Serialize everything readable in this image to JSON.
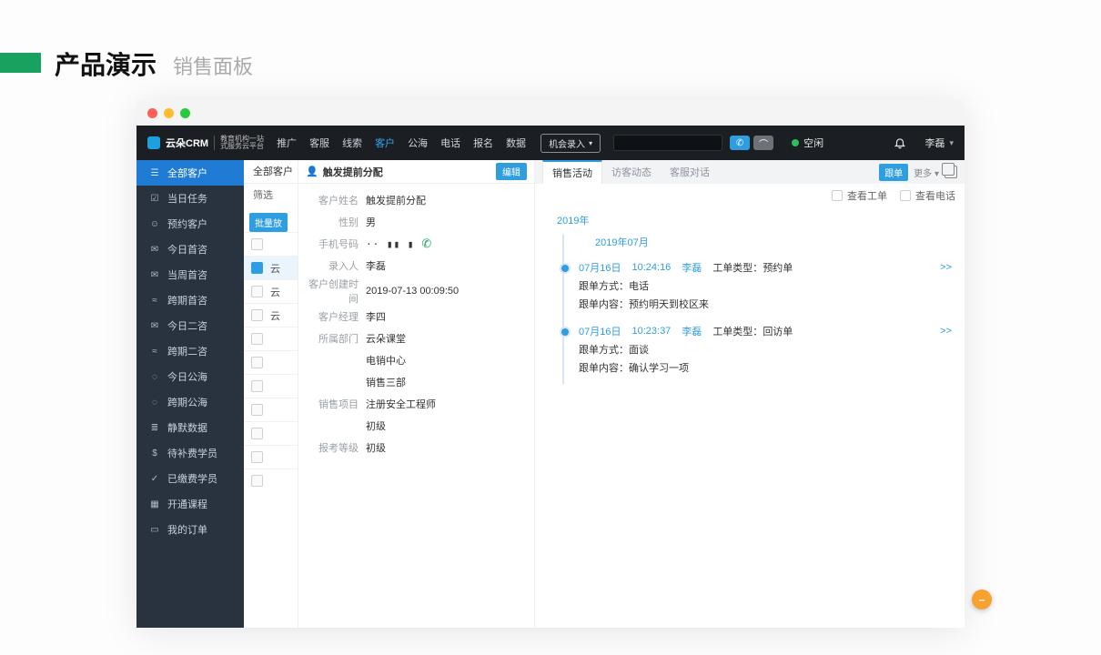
{
  "page": {
    "title": "产品演示",
    "subtitle": "销售面板"
  },
  "topnav": {
    "logo": {
      "brand": "云朵CRM",
      "sub1": "教育机构一站",
      "sub2": "式服务云平台"
    },
    "items": [
      "推广",
      "客服",
      "线索",
      "客户",
      "公海",
      "电话",
      "报名",
      "数据"
    ],
    "active_index": 3,
    "opportunity": "机会录入",
    "status_label": "空闲",
    "status_color": "#29c05a",
    "user": "李磊"
  },
  "sidebar": {
    "items": [
      {
        "icon": "users",
        "label": "全部客户",
        "head": true
      },
      {
        "icon": "task",
        "label": "当日任务"
      },
      {
        "icon": "person",
        "label": "预约客户"
      },
      {
        "icon": "chat",
        "label": "今日首咨"
      },
      {
        "icon": "chat",
        "label": "当周首咨"
      },
      {
        "icon": "wave",
        "label": "跨期首咨"
      },
      {
        "icon": "chat",
        "label": "今日二咨"
      },
      {
        "icon": "wave",
        "label": "跨期二咨"
      },
      {
        "icon": "sea",
        "label": "今日公海"
      },
      {
        "icon": "sea",
        "label": "跨期公海"
      },
      {
        "icon": "db",
        "label": "静默数据"
      },
      {
        "icon": "pay",
        "label": "待补费学员"
      },
      {
        "icon": "paid",
        "label": "已缴费学员"
      },
      {
        "icon": "course",
        "label": "开通课程"
      },
      {
        "icon": "order",
        "label": "我的订单"
      }
    ]
  },
  "mid": {
    "head": "全部客户",
    "filter": "筛选",
    "batch_badge": "批量放",
    "rows": [
      {
        "label": "",
        "chk": false
      },
      {
        "label": "云",
        "chk": true
      },
      {
        "label": "云",
        "chk": false
      },
      {
        "label": "云",
        "chk": false
      },
      {
        "label": "",
        "chk": false
      },
      {
        "label": "",
        "chk": false
      },
      {
        "label": "",
        "chk": false
      },
      {
        "label": "",
        "chk": false
      },
      {
        "label": "",
        "chk": false
      },
      {
        "label": "",
        "chk": false
      },
      {
        "label": "",
        "chk": false
      }
    ]
  },
  "detail": {
    "title": "触发提前分配",
    "edit": "编辑",
    "fields": [
      {
        "label": "客户姓名",
        "value": "触发提前分配"
      },
      {
        "label": "性别",
        "value": "男"
      },
      {
        "label": "手机号码",
        "value": "masked",
        "phone": true
      },
      {
        "label": "录入人",
        "value": "李磊"
      },
      {
        "label": "客户创建时间",
        "value": "2019-07-13 00:09:50"
      },
      {
        "label": "客户经理",
        "value": "李四"
      },
      {
        "label": "所属部门",
        "value": "云朵课堂"
      },
      {
        "label": "",
        "value": "电销中心"
      },
      {
        "label": "",
        "value": "销售三部"
      },
      {
        "label": "销售项目",
        "value": "注册安全工程师"
      },
      {
        "label": "",
        "value": "初级"
      },
      {
        "label": "报考等级",
        "value": "初级"
      }
    ]
  },
  "activity": {
    "tabs": [
      "销售活动",
      "访客动态",
      "客服对话"
    ],
    "active_tab": 0,
    "pill": "跟单",
    "more": "更多 ▾",
    "filters": {
      "ticket": "查看工单",
      "call": "查看电话"
    },
    "year": "2019年",
    "month": "2019年07月",
    "timeline": [
      {
        "date": "07月16日",
        "time": "10:24:16",
        "user": "李磊",
        "type_label": "工单类型：",
        "type_value": "预约单",
        "method_label": "跟单方式：",
        "method_value": "电话",
        "content_label": "跟单内容：",
        "content_value": "预约明天到校区来"
      },
      {
        "date": "07月16日",
        "time": "10:23:37",
        "user": "李磊",
        "type_label": "工单类型：",
        "type_value": "回访单",
        "method_label": "跟单方式：",
        "method_value": "面谈",
        "content_label": "跟单内容：",
        "content_value": "确认学习一项"
      }
    ],
    "expand": ">>"
  },
  "fab": "–"
}
